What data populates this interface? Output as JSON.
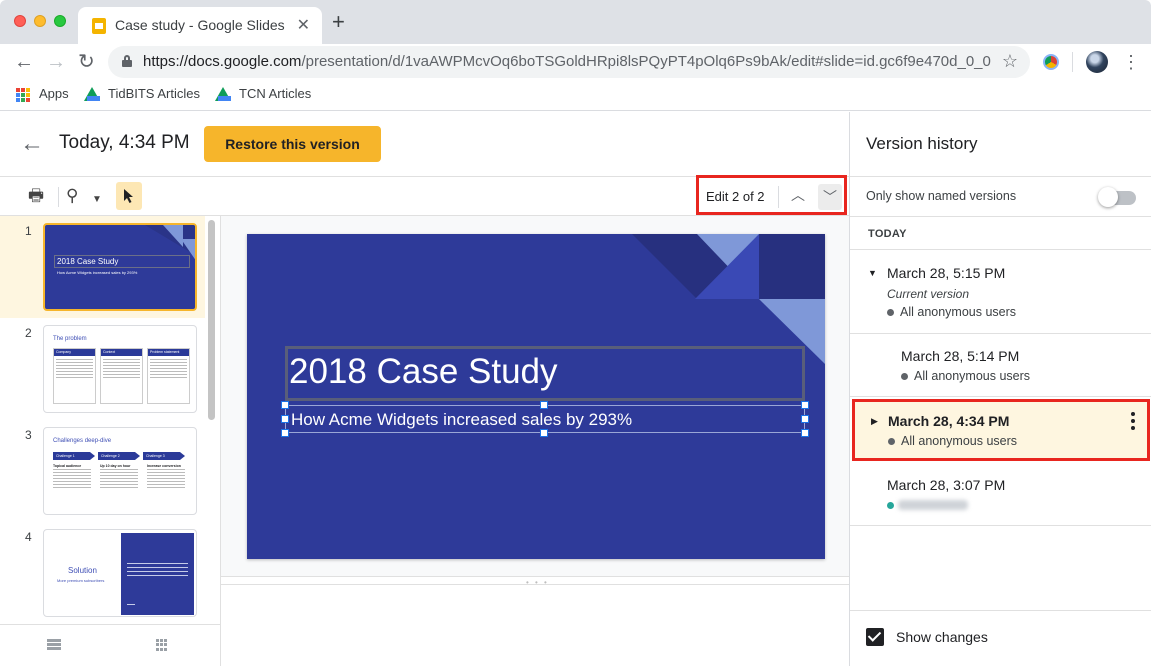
{
  "browser": {
    "tab_title": "Case study - Google Slides",
    "url_host": "https://docs.google.com",
    "url_path": "/presentation/d/1vaAWPMcvOq6boTSGoldHRpi8lsPQyPT4pOlq6Ps9bAk/edit#slide=id.gc6f9e470d_0_0",
    "bookmarks": [
      {
        "label": "Apps",
        "icon": "apps-grid-icon"
      },
      {
        "label": "TidBITS Articles",
        "icon": "google-drive-icon"
      },
      {
        "label": "TCN Articles",
        "icon": "google-drive-icon"
      }
    ]
  },
  "header": {
    "version_title": "Today, 4:34 PM",
    "restore_label": "Restore this version"
  },
  "toolbar": {
    "edit_counter": "Edit 2 of 2"
  },
  "filmstrip": {
    "slides": [
      {
        "number": "1",
        "title": "2018 Case Study",
        "subtitle": "How Acme Widgets increased sales by 293%"
      },
      {
        "number": "2",
        "title": "The problem",
        "columns": [
          "Company",
          "Context",
          "Problem statement"
        ]
      },
      {
        "number": "3",
        "title": "Challenges deep-dive",
        "columns": [
          "Challenge 1",
          "Challenge 2",
          "Challenge 3"
        ],
        "subheads": [
          "Topical audience",
          "Up 10 day on hour",
          "Increase conversion"
        ]
      },
      {
        "number": "4",
        "title": "Solution",
        "subtitle": "More premium subscribers"
      }
    ]
  },
  "slide": {
    "title": "2018 Case Study",
    "subtitle": "How Acme Widgets increased sales by 293%"
  },
  "version_history": {
    "title": "Version history",
    "filter_label": "Only show named versions",
    "filter_on": false,
    "section": "TODAY",
    "versions": [
      {
        "date": "March 28, 5:15 PM",
        "note": "Current version",
        "user": "All anonymous users",
        "dot_color": "#5f6368"
      },
      {
        "date": "March 28, 5:14 PM",
        "user": "All anonymous users",
        "dot_color": "#5f6368"
      },
      {
        "date": "March 28, 4:34 PM",
        "user": "All anonymous users",
        "dot_color": "#5f6368",
        "selected": true
      },
      {
        "date": "March 28, 3:07 PM",
        "user": "",
        "dot_color": "#26a69a"
      }
    ],
    "show_changes_label": "Show changes",
    "show_changes_checked": true
  },
  "colors": {
    "accent_yellow": "#f6b52b",
    "highlight_red": "#e8261f",
    "slide_blue": "#2e3a99"
  }
}
